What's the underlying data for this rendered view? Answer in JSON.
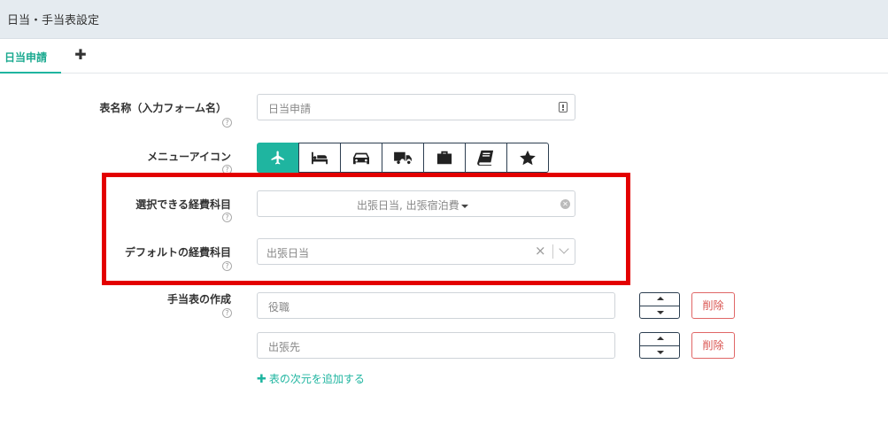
{
  "header": {
    "title": "日当・手当表設定"
  },
  "tabs": [
    {
      "label": "日当申請"
    }
  ],
  "tab_add_icon": "plus-icon",
  "form": {
    "table_name": {
      "label": "表名称（入力フォーム名）",
      "value": "日当申請"
    },
    "menu_icon": {
      "label": "メニューアイコン",
      "icons": [
        "airplane-icon",
        "bed-icon",
        "car-icon",
        "truck-icon",
        "briefcase-icon",
        "book-icon",
        "star-icon"
      ],
      "selected_index": 0
    },
    "selectable_items": {
      "label": "選択できる経費科目",
      "value": "出張日当, 出張宿泊費"
    },
    "default_item": {
      "label": "デフォルトの経費科目",
      "value": "出張日当"
    },
    "allowance_table": {
      "label": "手当表の作成",
      "dimensions": [
        {
          "value": "役職",
          "delete_label": "削除"
        },
        {
          "value": "出張先",
          "delete_label": "削除"
        }
      ],
      "add_label": "表の次元を追加する"
    }
  },
  "colors": {
    "accent": "#1fb5a0",
    "highlight": "#e30000",
    "danger": "#d9534f",
    "header_bg": "#e5ebf0"
  }
}
